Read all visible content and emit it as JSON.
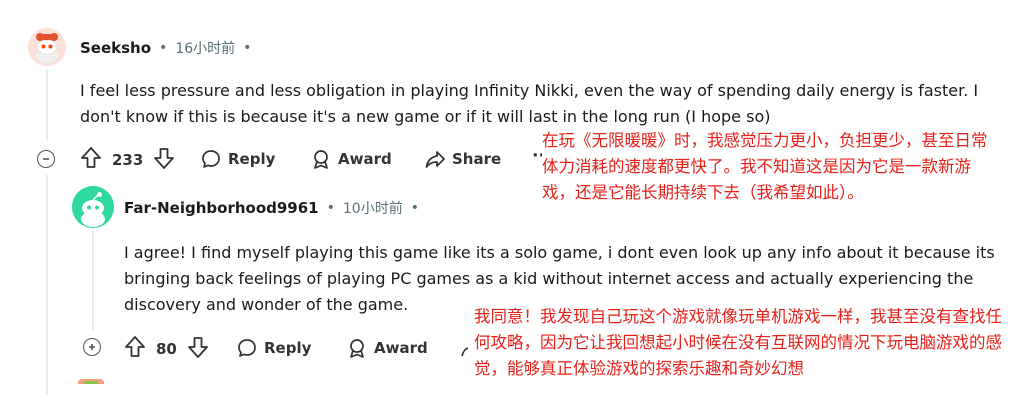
{
  "comment1": {
    "username": "Seeksho",
    "time": "16小时前",
    "dot": "•",
    "body": "I feel less pressure and less obligation in playing Infinity Nikki, even the way of spending daily energy is faster. I don't know if this is because it's a new game or if it will last in the long run (I hope so)",
    "votes": "233",
    "reply_label": "Reply",
    "award_label": "Award",
    "share_label": "Share",
    "more_label": "···"
  },
  "comment2": {
    "username": "Far-Neighborhood9961",
    "time": "10小时前",
    "dot": "•",
    "body": "I agree! I find myself playing this game like its a solo game, i dont even look up any info about it because its bringing back feelings of playing PC games as a kid without internet access and actually experiencing the discovery and wonder of the game.",
    "votes": "80",
    "reply_label": "Reply",
    "award_label": "Award"
  },
  "translations": {
    "t1": "在玩《无限暖暖》时，我感觉压力更小，负担更少，甚至日常体力消耗的速度都更快了。我不知道这是因为它是一款新游戏，还是它能长期持续下去（我希望如此）。",
    "t2": "我同意！我发现自己玩这个游戏就像玩单机游戏一样，我甚至没有查找任何攻略，因为它让我回想起小时候在没有互联网的情况下玩电脑游戏的感觉，能够真正体验游戏的探索乐趣和奇妙幻想"
  },
  "colors": {
    "translation": "#e8201a",
    "avatar1_bg": "#fde0d8",
    "avatar2_bg": "#2fd8a0",
    "meta": "#576f76"
  },
  "icons": [
    "collapse-icon",
    "upvote-icon",
    "downvote-icon",
    "reply-icon",
    "award-icon",
    "share-icon",
    "more-icon",
    "expand-icon"
  ]
}
